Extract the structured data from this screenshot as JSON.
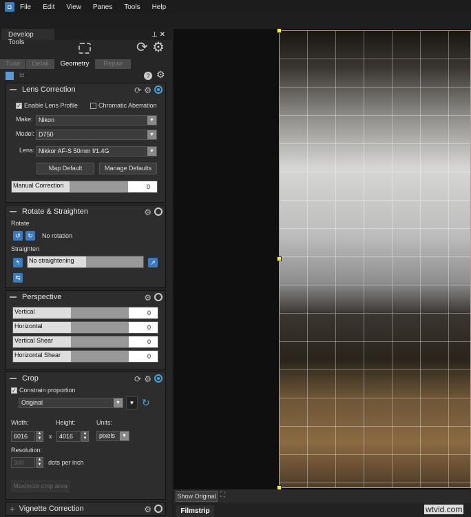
{
  "menu": [
    "File",
    "Edit",
    "View",
    "Panes",
    "Tools",
    "Help"
  ],
  "panel": {
    "title": "Develop Tools",
    "tabs": [
      "Tune",
      "Detail",
      "Geometry",
      "Repair"
    ],
    "active_tab": "Geometry"
  },
  "lens": {
    "title": "Lens Correction",
    "enable_profile": "Enable Lens Profile",
    "enable_checked": true,
    "chromatic": "Chromatic Aberration",
    "chromatic_checked": false,
    "make_label": "Make:",
    "make": "Nikon",
    "model_label": "Model:",
    "model": "D750",
    "lens_label": "Lens:",
    "lens": "Nikkor AF-S 50mm f/1.4G",
    "map_default": "Map Default",
    "manage_defaults": "Manage Defaults",
    "manual_label": "Manual Correction",
    "manual_value": "0"
  },
  "rotate": {
    "title": "Rotate & Straighten",
    "rotate_label": "Rotate",
    "rotation": "No rotation",
    "straighten_label": "Straighten",
    "straighten": "No straightening"
  },
  "perspective": {
    "title": "Perspective",
    "sliders": [
      {
        "label": "Vertical",
        "value": "0"
      },
      {
        "label": "Horizontal",
        "value": "0"
      },
      {
        "label": "Vertical Shear",
        "value": "0"
      },
      {
        "label": "Horizontal Shear",
        "value": "0"
      }
    ]
  },
  "crop": {
    "title": "Crop",
    "constrain": "Constrain proportion",
    "constrain_checked": true,
    "proportion": "Original",
    "width_label": "Width:",
    "width": "6016",
    "x": "x",
    "height_label": "Height:",
    "height": "4016",
    "units_label": "Units:",
    "units": "pixels",
    "resolution_label": "Resolution:",
    "resolution": "300",
    "dpi": "dots per inch",
    "maximize": "Maximize crop area"
  },
  "vignette": {
    "title": "Vignette Correction"
  },
  "view": {
    "show_original": "Show Original",
    "filmstrip": "Filmstrip"
  },
  "watermark": "wtvid.com",
  "colors": {
    "accent": "#4aa3df",
    "crop_handle": "#ffff00"
  }
}
